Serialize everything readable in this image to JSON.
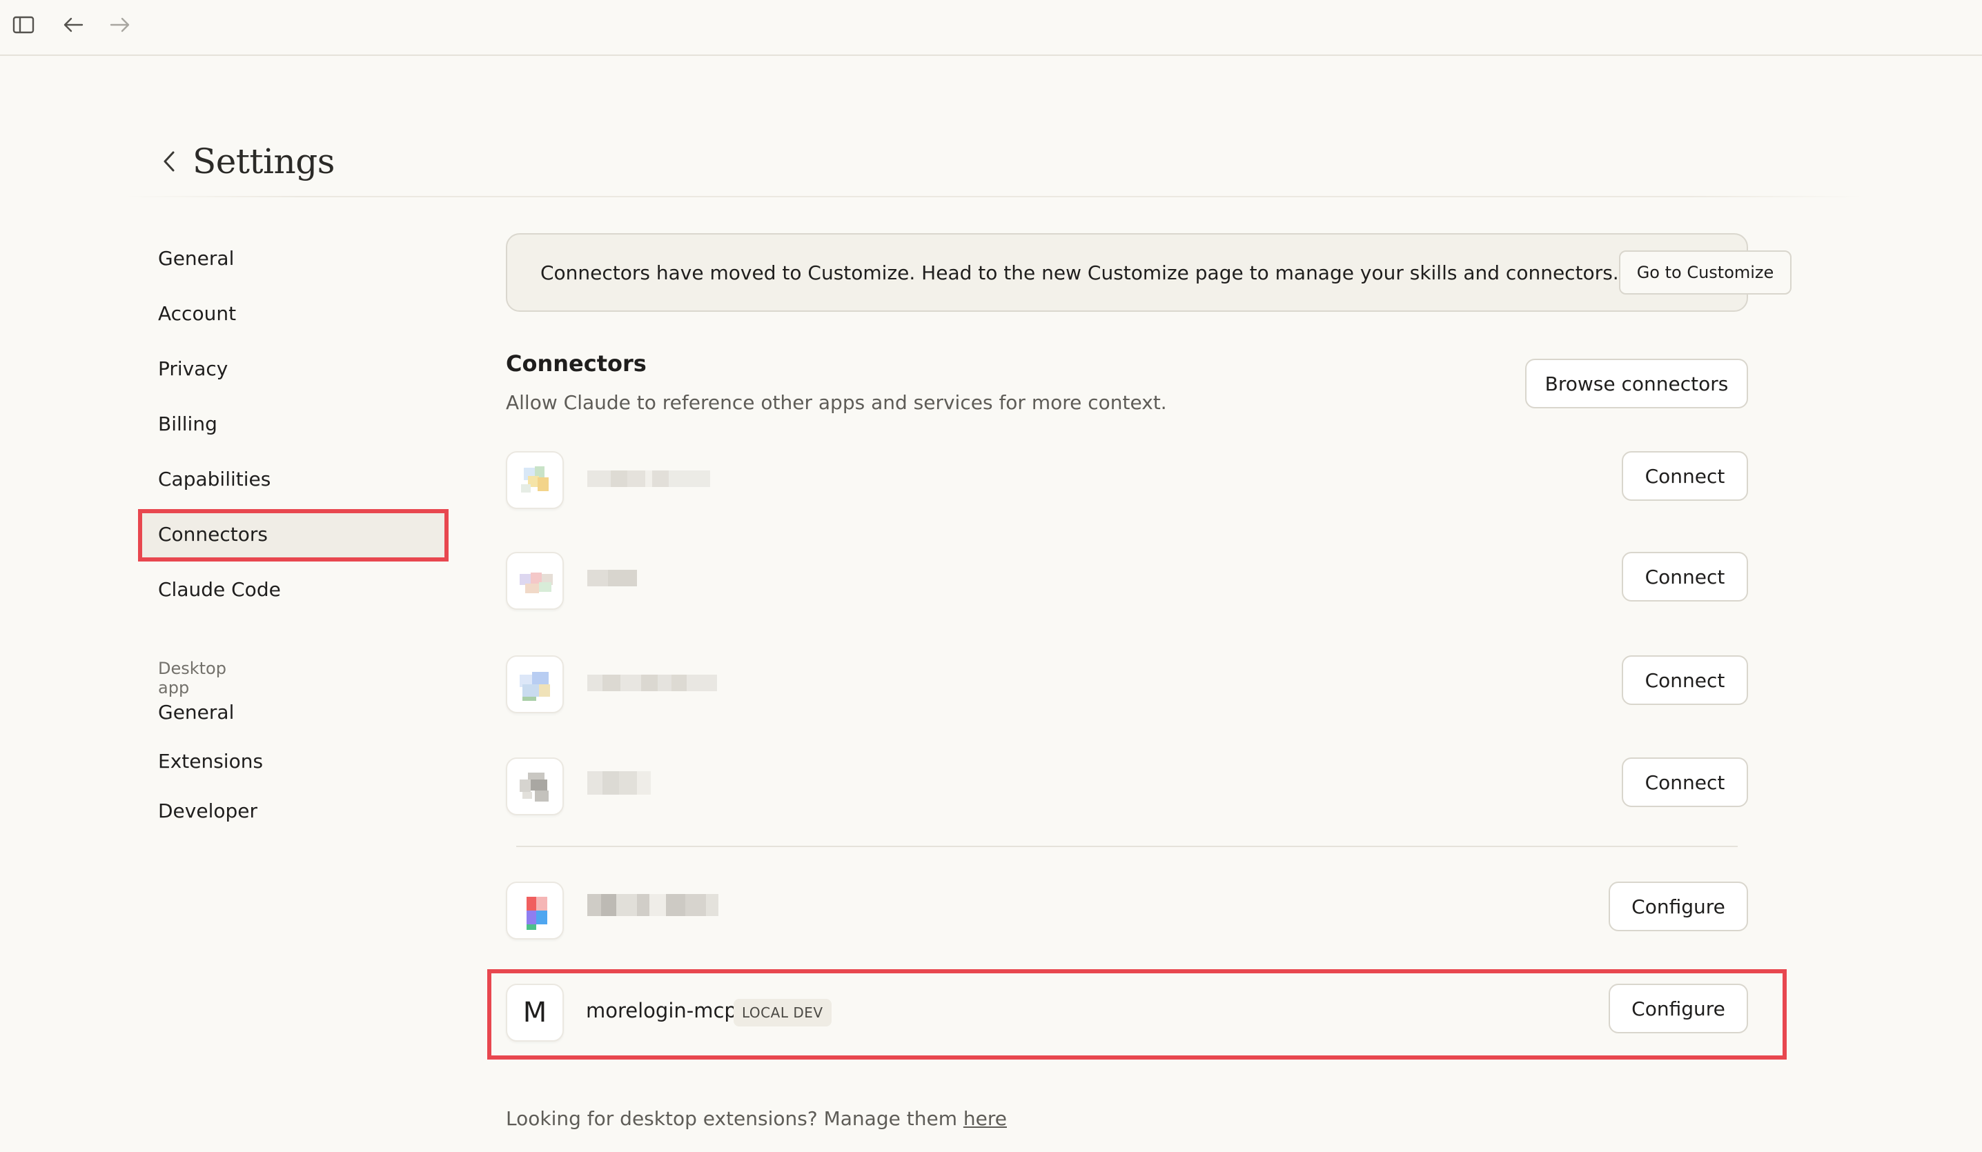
{
  "toolbar": {
    "sidebar_toggle_icon": "sidebar-panel-icon",
    "back_icon": "arrow-left-icon",
    "forward_icon": "arrow-right-icon"
  },
  "header": {
    "back_icon": "chevron-left-icon",
    "title": "Settings"
  },
  "sidebar": {
    "items": [
      {
        "label": "General"
      },
      {
        "label": "Account"
      },
      {
        "label": "Privacy"
      },
      {
        "label": "Billing"
      },
      {
        "label": "Capabilities"
      },
      {
        "label": "Connectors",
        "active": true
      },
      {
        "label": "Claude Code"
      }
    ],
    "desktop_section": {
      "heading": "Desktop app",
      "items": [
        {
          "label": "General"
        },
        {
          "label": "Extensions"
        },
        {
          "label": "Developer"
        }
      ]
    }
  },
  "banner": {
    "text": "Connectors have moved to Customize. Head to the new Customize page to manage your skills and connectors.",
    "button_label": "Go to Customize"
  },
  "connectors": {
    "title": "Connectors",
    "subtitle": "Allow Claude to reference other apps and services for more context.",
    "browse_label": "Browse connectors",
    "rows": [
      {
        "name": "",
        "blurred": true,
        "action": "Connect"
      },
      {
        "name": "",
        "blurred": true,
        "action": "Connect"
      },
      {
        "name": "",
        "blurred": true,
        "action": "Connect"
      },
      {
        "name": "",
        "blurred": true,
        "action": "Connect"
      },
      {
        "name": "",
        "blurred": true,
        "action": "Configure"
      },
      {
        "name": "morelogin-mcp",
        "badge": "LOCAL DEV",
        "logo_letter": "M",
        "action": "Configure"
      }
    ]
  },
  "footer": {
    "text": "Looking for desktop extensions? Manage them ",
    "link": "here"
  },
  "colors": {
    "background": "#faf9f5",
    "annotation": "#e8474f",
    "active_nav": "#f0ede6"
  }
}
